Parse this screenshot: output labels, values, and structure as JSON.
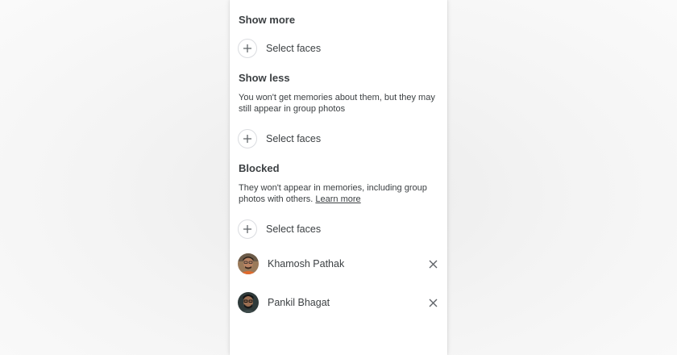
{
  "show_more": {
    "title": "Show more",
    "select_label": "Select faces"
  },
  "show_less": {
    "title": "Show less",
    "description": "You won't get memories about them, but they may still appear in group photos",
    "select_label": "Select faces"
  },
  "blocked": {
    "title": "Blocked",
    "description": "They won't appear in memories, including group photos with others.",
    "learn_more": "Learn more",
    "select_label": "Select faces",
    "people": [
      {
        "name": "Khamosh Pathak",
        "avatar_icon": "person-photo-icon"
      },
      {
        "name": "Pankil Bhagat",
        "avatar_icon": "person-photo-icon"
      }
    ]
  },
  "colors": {
    "text": "#3c4043",
    "icon": "#5f6368",
    "circle_border": "#dadce0",
    "panel": "#ffffff"
  }
}
